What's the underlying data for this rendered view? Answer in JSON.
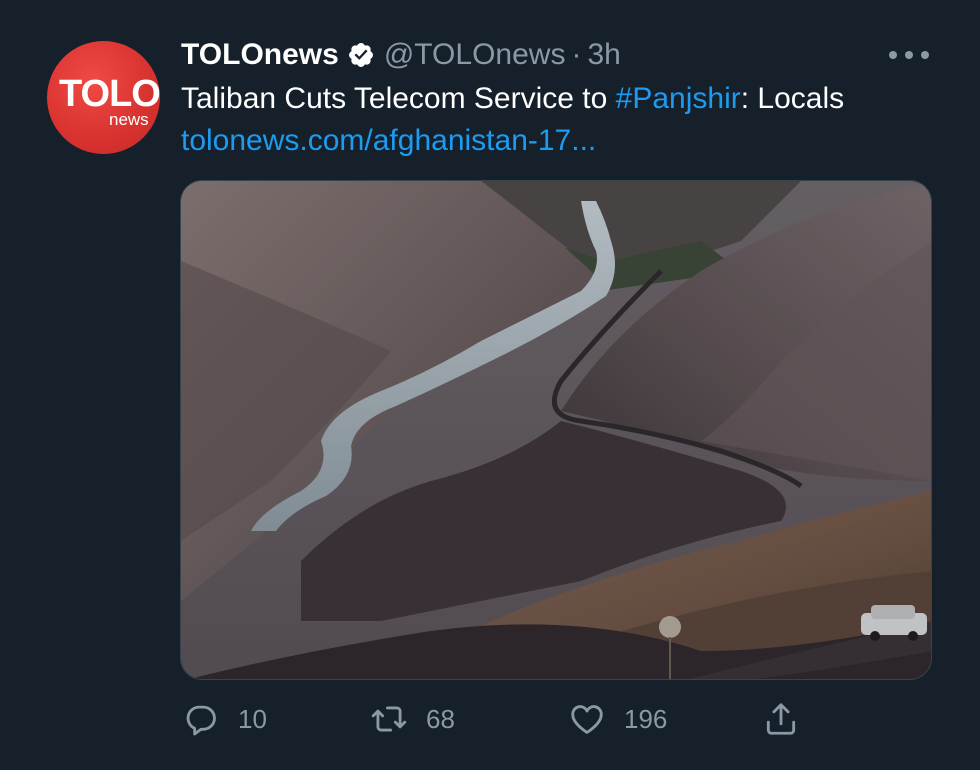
{
  "author": {
    "avatar_text": "TOLO",
    "avatar_subtext": "news",
    "display_name": "TOLOnews",
    "handle": "@TOLOnews",
    "separator": "·",
    "time": "3h",
    "verified": true
  },
  "tweet": {
    "text_before": "Taliban Cuts Telecom Service to ",
    "hashtag": "#Panjshir",
    "text_after": ": Locals",
    "link": "tolonews.com/afghanistan-17..."
  },
  "media": {
    "description_icon": "mountain-valley-photo"
  },
  "actions": {
    "replies": "10",
    "retweets": "68",
    "likes": "196"
  },
  "colors": {
    "background": "#15202b",
    "link": "#1d9bf0",
    "muted": "#8b98a5",
    "brand_red": "#d8322f"
  }
}
